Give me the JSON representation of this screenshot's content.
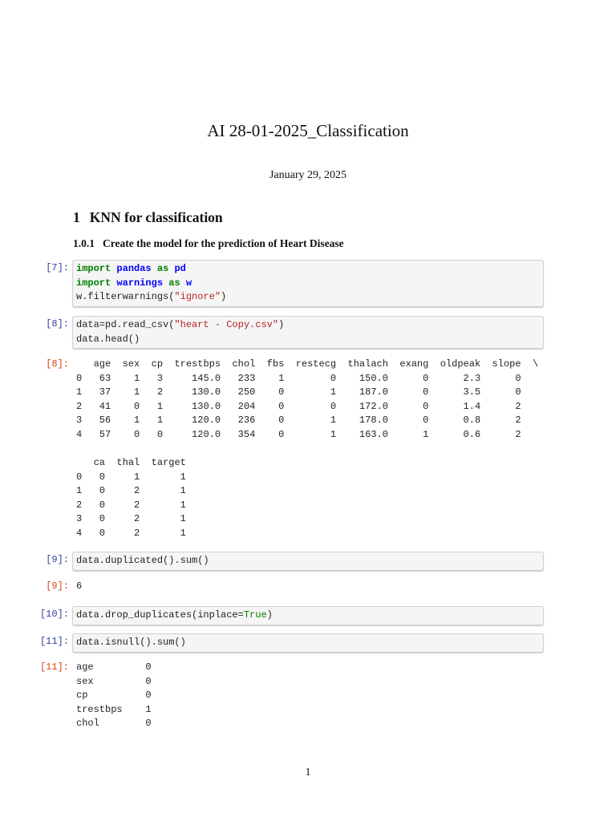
{
  "title": "AI 28-01-2025_Classification",
  "date": "January 29, 2025",
  "section": {
    "number": "1",
    "title": "KNN for classification"
  },
  "subsection": {
    "number": "1.0.1",
    "title": "Create the model for the prediction of Heart Disease"
  },
  "cells": {
    "c7": {
      "prompt": "[7]:",
      "l1": [
        "import",
        " ",
        "pandas",
        " ",
        "as",
        " ",
        "pd"
      ],
      "l2": [
        "import",
        " ",
        "warnings",
        " ",
        "as",
        " ",
        "w"
      ],
      "l3": [
        "w.filterwarnings(",
        "\"ignore\"",
        ")"
      ]
    },
    "c8": {
      "prompt": "[8]:",
      "out_prompt": "[8]:",
      "l1": [
        "data=pd.read_csv(",
        "\"heart - Copy.csv\"",
        ")"
      ],
      "l2": "data.head()"
    },
    "c9": {
      "prompt": "[9]:",
      "out_prompt": "[9]:",
      "code": "data.duplicated().sum()",
      "output": "6"
    },
    "c10": {
      "prompt": "[10]:",
      "l1": [
        "data.drop_duplicates(inplace=",
        "True",
        ")"
      ]
    },
    "c11": {
      "prompt": "[11]:",
      "out_prompt": "[11]:",
      "code": "data.isnull().sum()"
    }
  },
  "head_table_1": {
    "columns": [
      "age",
      "sex",
      "cp",
      "trestbps",
      "chol",
      "fbs",
      "restecg",
      "thalach",
      "exang",
      "oldpeak",
      "slope"
    ],
    "continuation": "\\",
    "index": [
      "0",
      "1",
      "2",
      "3",
      "4"
    ],
    "rows": [
      [
        "63",
        "1",
        "3",
        "145.0",
        "233",
        "1",
        "0",
        "150.0",
        "0",
        "2.3",
        "0"
      ],
      [
        "37",
        "1",
        "2",
        "130.0",
        "250",
        "0",
        "1",
        "187.0",
        "0",
        "3.5",
        "0"
      ],
      [
        "41",
        "0",
        "1",
        "130.0",
        "204",
        "0",
        "0",
        "172.0",
        "0",
        "1.4",
        "2"
      ],
      [
        "56",
        "1",
        "1",
        "120.0",
        "236",
        "0",
        "1",
        "178.0",
        "0",
        "0.8",
        "2"
      ],
      [
        "57",
        "0",
        "0",
        "120.0",
        "354",
        "0",
        "1",
        "163.0",
        "1",
        "0.6",
        "2"
      ]
    ]
  },
  "head_table_2": {
    "columns": [
      "ca",
      "thal",
      "target"
    ],
    "index": [
      "0",
      "1",
      "2",
      "3",
      "4"
    ],
    "rows": [
      [
        "0",
        "1",
        "1"
      ],
      [
        "0",
        "2",
        "1"
      ],
      [
        "0",
        "2",
        "1"
      ],
      [
        "0",
        "2",
        "1"
      ],
      [
        "0",
        "2",
        "1"
      ]
    ]
  },
  "isnull_series": [
    [
      "age",
      "0"
    ],
    [
      "sex",
      "0"
    ],
    [
      "cp",
      "0"
    ],
    [
      "trestbps",
      "1"
    ],
    [
      "chol",
      "0"
    ]
  ],
  "page_number": "1"
}
